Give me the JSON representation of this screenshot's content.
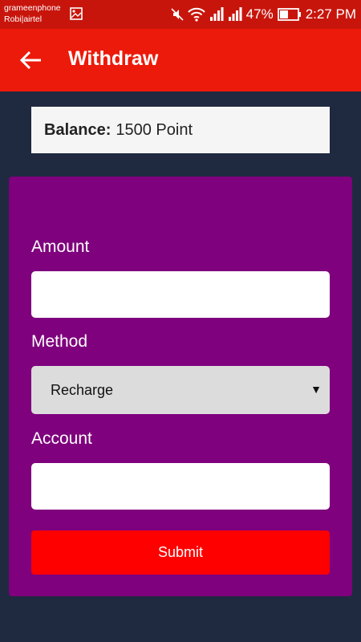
{
  "status_bar": {
    "carrier_1": "grameenphone",
    "carrier_2": "Robi|airtel",
    "battery": "47%",
    "time": "2:27 PM"
  },
  "app_bar": {
    "title": "Withdraw",
    "back_icon": "arrow-left-icon"
  },
  "balance": {
    "label": "Balance:",
    "value": "1500 Point"
  },
  "form": {
    "amount_label": "Amount",
    "amount_value": "",
    "method_label": "Method",
    "method_selected": "Recharge",
    "account_label": "Account",
    "account_value": "",
    "submit_label": "Submit"
  },
  "colors": {
    "status_bar": "#c8150c",
    "app_bar": "#ec1a0a",
    "background": "#1f2940",
    "form_card": "#7f017d",
    "submit": "#ff0000"
  }
}
